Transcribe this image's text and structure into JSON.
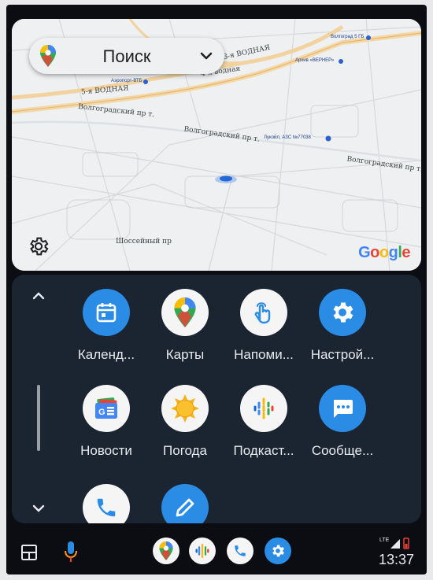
{
  "map": {
    "search_label": "Поиск",
    "streets": [
      "3-я ВОДНАЯ",
      "4-я водная",
      "5-я ВОДНАЯ",
      "Волгоградский пр т.",
      "Волгоградский пр т.",
      "Волгоградский пр т.",
      "Шоссейный пр"
    ],
    "pois": [
      "Лукойл, АЗС №77038",
      "Архив «ВЕРНЕР»",
      "Аэропорт-ВТБ",
      "Волгоград 5 ГБ"
    ],
    "brand": "Google"
  },
  "apps": [
    {
      "label": "Календ...",
      "icon": "calendar-icon"
    },
    {
      "label": "Карты",
      "icon": "maps-icon"
    },
    {
      "label": "Напоми...",
      "icon": "reminder-icon"
    },
    {
      "label": "Настрой...",
      "icon": "settings-icon"
    },
    {
      "label": "Новости",
      "icon": "news-icon"
    },
    {
      "label": "Погода",
      "icon": "weather-icon"
    },
    {
      "label": "Подкаст...",
      "icon": "podcasts-icon"
    },
    {
      "label": "Сообще...",
      "icon": "messages-icon"
    },
    {
      "label": "",
      "icon": "phone-icon"
    },
    {
      "label": "",
      "icon": "edit-icon"
    }
  ],
  "dock": [
    "maps-icon",
    "podcasts-icon",
    "phone-icon",
    "settings-icon"
  ],
  "status": {
    "network": "LTE",
    "time": "13:37"
  },
  "colors": {
    "accent_blue": "#2b8ce6",
    "panel": "#1b2431",
    "background": "#0b0d12",
    "mic_orange": "#f28b1a"
  }
}
